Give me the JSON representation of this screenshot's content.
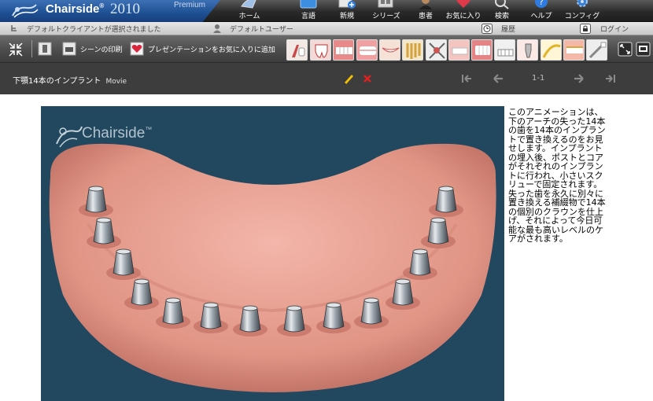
{
  "app": {
    "brand_name": "Chairside",
    "brand_mark": "®",
    "brand_year": "2010",
    "edition": "Premium"
  },
  "nav": {
    "items": [
      {
        "label": "ホーム",
        "icon": "home-icon"
      },
      {
        "label": "言語",
        "icon": "language-icon"
      },
      {
        "label": "新規",
        "icon": "new-icon"
      },
      {
        "label": "シリーズ",
        "icon": "series-icon"
      },
      {
        "label": "患者",
        "icon": "patient-icon"
      },
      {
        "label": "お気に入り",
        "icon": "favorites-icon"
      },
      {
        "label": "検索",
        "icon": "search-icon"
      },
      {
        "label": "ヘルプ",
        "icon": "help-icon"
      },
      {
        "label": "コンフィグ",
        "icon": "config-icon"
      }
    ]
  },
  "status": {
    "client": "デフォルトクライアントが選択されました",
    "user": "デフォルトユーザー",
    "history": "履歴",
    "login": "ログイン"
  },
  "toolbar": {
    "print_label": "シーンの印刷",
    "add_favorite_label": "プレゼンテーションをお気に入りに追加"
  },
  "title_bar": {
    "title": "下顎14本のインプラント",
    "type": "Movie",
    "page": "1-1"
  },
  "player": {
    "watermark": "Chairside",
    "watermark_mark": "™"
  },
  "description": "このアニメーションは、下のアーチの失った14本の歯を14本のインプラントで置き換えるのをお見せします。インプラントの埋入後、ポストとコアがそれぞれのインプラントに行われ、小さいスクリューで固定されます。失った歯を永久に別々に置き換える補綴物で14本の個別のクラウンを仕上げ、それによって今日可能な最も高いレベルのケアがされます。",
  "colors": {
    "brand_blue": "#1e4f93",
    "title_bar": "#3d3d3d",
    "player_bg": "#21485f",
    "gum": "#e8a093",
    "edit_icon": "#f2c200",
    "delete_icon": "#e02020"
  }
}
